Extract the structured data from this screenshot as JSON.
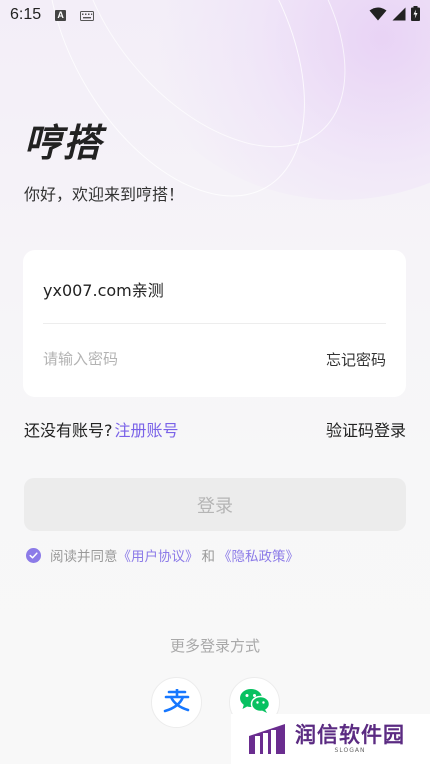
{
  "status_bar": {
    "time": "6:15",
    "notification_letter": "A"
  },
  "app": {
    "title": "哼搭",
    "welcome": "你好，欢迎来到哼搭！"
  },
  "login_form": {
    "account_value": "yx007.com亲测",
    "password_placeholder": "请输入密码",
    "forgot_password": "忘记密码"
  },
  "links": {
    "no_account": "还没有账号?",
    "register": "注册账号",
    "sms_login": "验证码登录"
  },
  "login_button": "登录",
  "agreement": {
    "prefix": "阅读并同意",
    "user_agreement": "《用户协议》",
    "and": "和",
    "privacy_policy": "《隐私政策》",
    "checked": true
  },
  "more_methods": "更多登录方式",
  "social": [
    {
      "name": "alipay",
      "icon": "alipay-icon",
      "color": "#1677ff"
    },
    {
      "name": "wechat",
      "icon": "wechat-icon",
      "color": "#07c160"
    }
  ],
  "watermark": {
    "text": "润信软件园",
    "slogan": "SLOGAN"
  },
  "colors": {
    "accent": "#7a62e8",
    "checkbox": "#8c7be8",
    "alipay": "#1677ff",
    "wechat": "#07c160"
  }
}
